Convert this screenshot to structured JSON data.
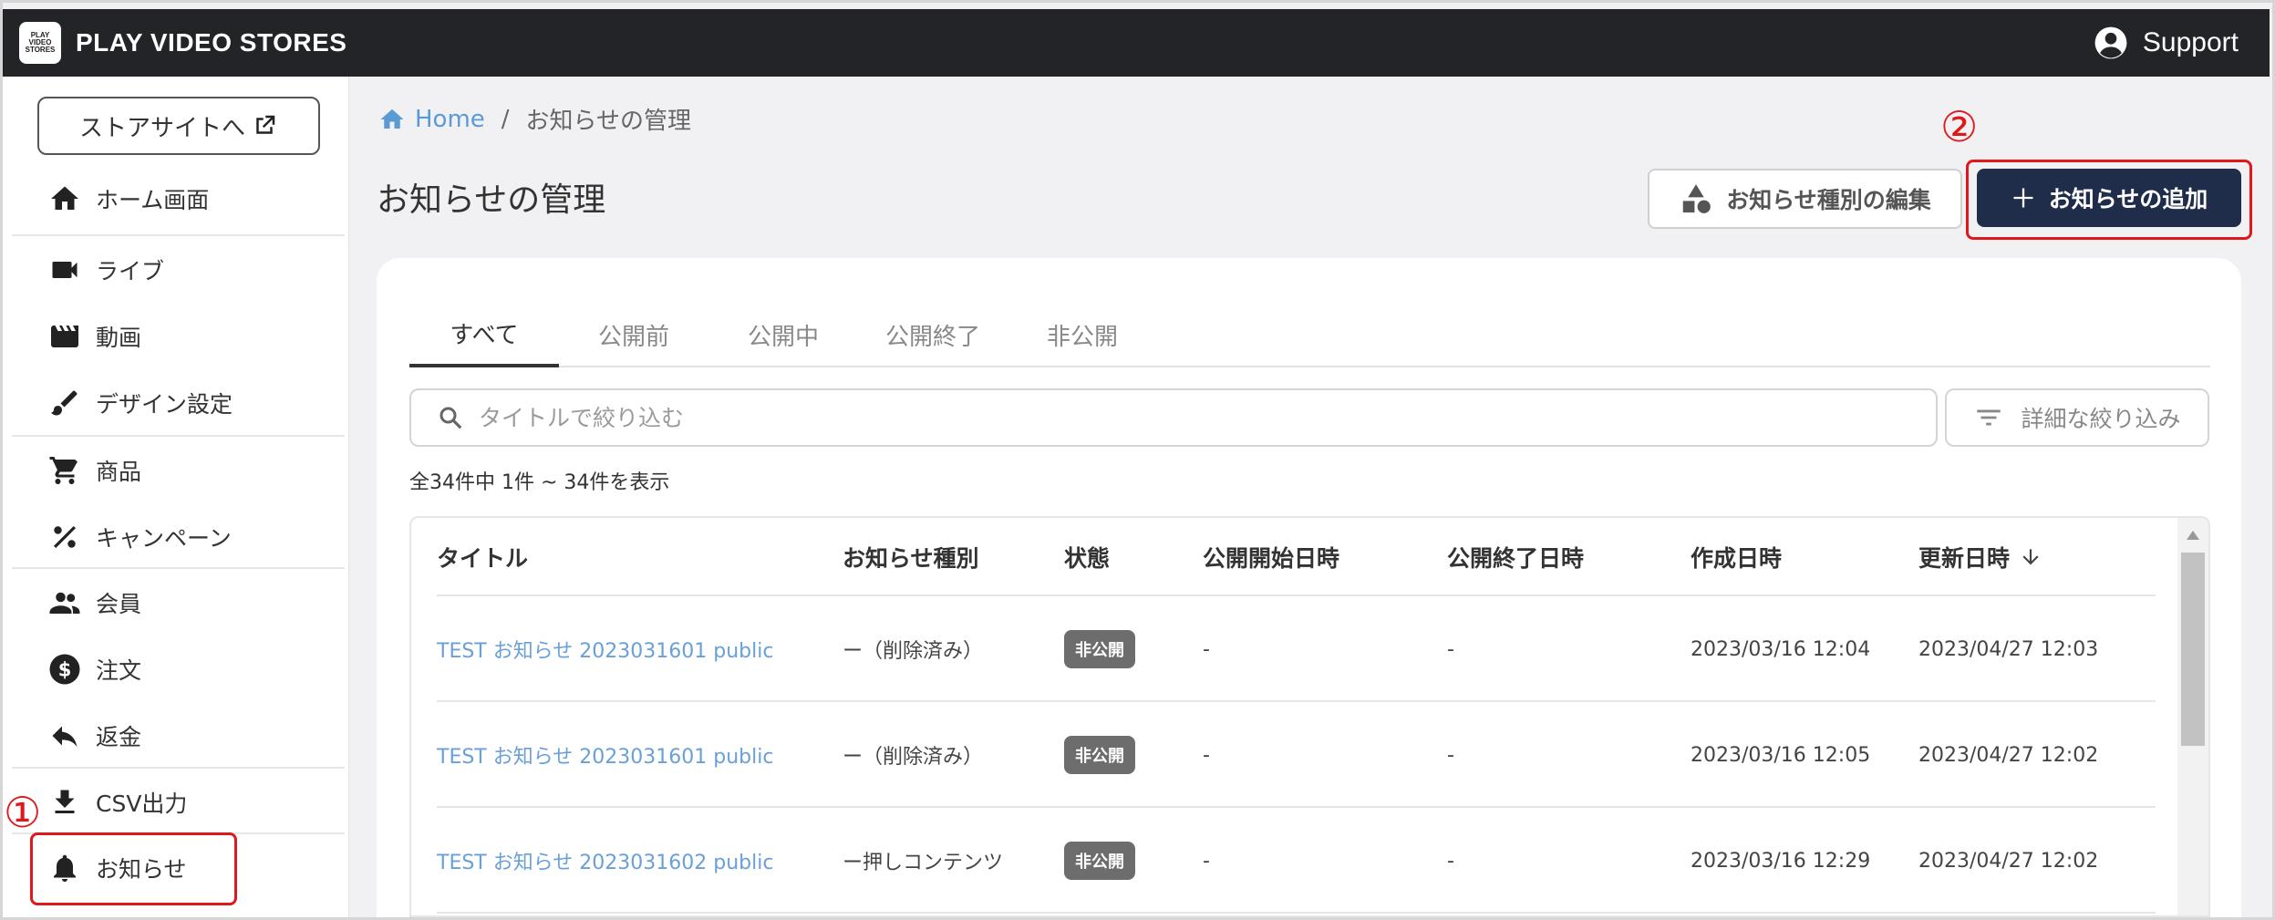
{
  "header": {
    "logo_lines": [
      "PLAY",
      "VIDEO",
      "STORES"
    ],
    "brand": "PLAY VIDEO STORES",
    "support_label": "Support"
  },
  "sidebar": {
    "store_button_label": "ストアサイトへ",
    "items": [
      {
        "label": "ホーム画面",
        "icon": "home-icon"
      },
      {
        "label": "ライブ",
        "icon": "video-camera-icon"
      },
      {
        "label": "動画",
        "icon": "clapperboard-icon"
      },
      {
        "label": "デザイン設定",
        "icon": "brush-icon"
      },
      {
        "label": "商品",
        "icon": "cart-icon"
      },
      {
        "label": "キャンペーン",
        "icon": "percent-icon"
      },
      {
        "label": "会員",
        "icon": "people-icon"
      },
      {
        "label": "注文",
        "icon": "dollar-icon"
      },
      {
        "label": "返金",
        "icon": "reply-icon"
      },
      {
        "label": "CSV出力",
        "icon": "download-icon"
      },
      {
        "label": "お知らせ",
        "icon": "bell-icon"
      }
    ]
  },
  "annotations": {
    "marker1": "①",
    "marker2": "②",
    "color": "#e0171b"
  },
  "breadcrumb": {
    "home": "Home",
    "separator": "/",
    "current": "お知らせの管理"
  },
  "page": {
    "title": "お知らせの管理",
    "edit_type_button": "お知らせ種別の編集",
    "add_button": "お知らせの追加"
  },
  "tabs": [
    "すべて",
    "公開前",
    "公開中",
    "公開終了",
    "非公開"
  ],
  "search": {
    "placeholder": "タイトルで絞り込む",
    "value": ""
  },
  "filter_button": "詳細な絞り込み",
  "count_text": "全34件中 1件 ~ 34件を表示",
  "table": {
    "columns": [
      "タイトル",
      "お知らせ種別",
      "状態",
      "公開開始日時",
      "公開終了日時",
      "作成日時",
      "更新日時"
    ],
    "rows": [
      {
        "title": "TEST お知らせ 2023031601 public",
        "type": "ー（削除済み）",
        "status": "非公開",
        "start": "-",
        "end": "-",
        "created": "2023/03/16 12:04",
        "updated": "2023/04/27 12:03"
      },
      {
        "title": "TEST お知らせ 2023031601 public",
        "type": "ー（削除済み）",
        "status": "非公開",
        "start": "-",
        "end": "-",
        "created": "2023/03/16 12:05",
        "updated": "2023/04/27 12:02"
      },
      {
        "title": "TEST お知らせ 2023031602 public",
        "type": "ー押しコンテンツ",
        "status": "非公開",
        "start": "-",
        "end": "-",
        "created": "2023/03/16 12:29",
        "updated": "2023/04/27 12:02"
      }
    ]
  },
  "colors": {
    "header_bg": "#222428",
    "primary_button": "#1f2d4a",
    "link": "#6aa0d8",
    "badge": "#6d6d6d"
  }
}
